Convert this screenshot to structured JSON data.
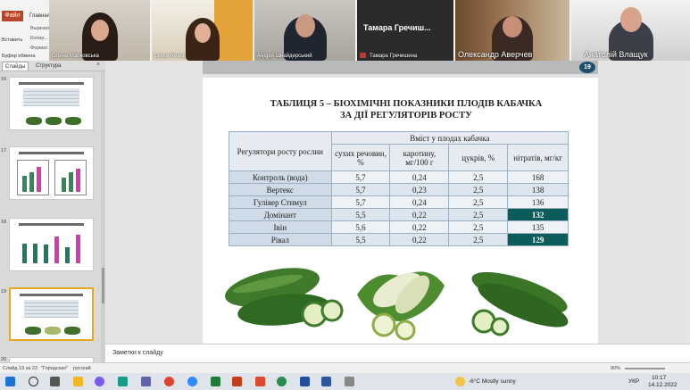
{
  "ribbon": {
    "file_label": "Файл",
    "home_tab": "Главная",
    "paste_label": "Вставить",
    "clipboard_label": "Буфер обмена",
    "cut_label": "Вырезать",
    "copy_label": "Копир...",
    "format_label": "Формат"
  },
  "participants": [
    {
      "name": "Олена Марковська"
    },
    {
      "name": "Lesya Revbo"
    },
    {
      "name": "Андрій Шнайдерський"
    },
    {
      "name": "Тамара Гречишина",
      "big_label": "Тамара  Гречиш..."
    },
    {
      "name": "Олександр Аверчев"
    },
    {
      "name": "Анатолій  Влащук"
    }
  ],
  "panel": {
    "tab_slides": "Слайды",
    "tab_structure": "Структура",
    "close": "×",
    "slide_numbers": [
      "16",
      "17",
      "18",
      "19",
      "20"
    ]
  },
  "slide": {
    "number": "19",
    "title_line1": "ТАБЛИЦЯ 5 – БІОХІМІЧНІ ПОКАЗНИКИ ПЛОДІВ КАБАЧКА",
    "title_line2": "ЗА ДІЇ РЕГУЛЯТОРІВ РОСТУ",
    "table": {
      "col0": "Регулятори росту рослин",
      "group_header": "Вміст у плодах кабачка",
      "headers": [
        "сухих речовин, %",
        "каротину, мг/100 г",
        "цукрів, %",
        "нітратів, мг/кг"
      ],
      "rows": [
        {
          "name": "Контроль (вода)",
          "values": [
            "5,7",
            "0,24",
            "2,5",
            "168"
          ]
        },
        {
          "name": "Вертекс",
          "values": [
            "5,7",
            "0,23",
            "2,5",
            "138"
          ]
        },
        {
          "name": "Гулівер Стимул",
          "values": [
            "5,7",
            "0,24",
            "2,5",
            "136"
          ]
        },
        {
          "name": "Домінант",
          "values": [
            "5,5",
            "0,22",
            "2,5",
            "132"
          ]
        },
        {
          "name": "Івін",
          "values": [
            "5,6",
            "0,22",
            "2,5",
            "135"
          ]
        },
        {
          "name": "Рівал",
          "values": [
            "5,5",
            "0,22",
            "2,5",
            "129"
          ]
        }
      ]
    }
  },
  "notes": {
    "placeholder": "Заметки к слайду"
  },
  "status": {
    "slide_info": "Слайд 19 из 23",
    "theme": "\"Городская\"",
    "language": "русский",
    "zoom": "90%"
  },
  "taskbar": {
    "weather": "-6°C  Mostly sunny",
    "lang": "УКР",
    "time": "10:17",
    "date": "14.12.2022"
  },
  "colors": {
    "highlight": "#0d5c5c",
    "badge": "#1d4e6d",
    "file": "#b7472a"
  }
}
